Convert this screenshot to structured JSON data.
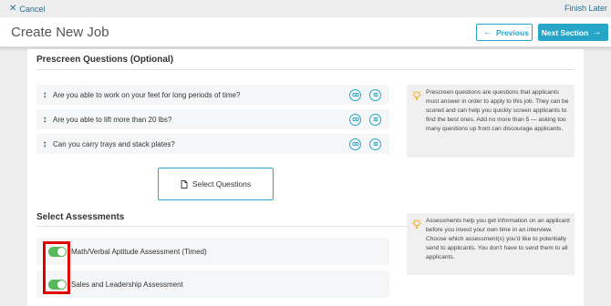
{
  "topbar": {
    "cancel_label": "Cancel",
    "finish_label": "Finish Later"
  },
  "header": {
    "title": "Create New Job",
    "previous_label": "Previous",
    "next_label": "Next Section"
  },
  "prescreen": {
    "title": "Prescreen Questions (Optional)",
    "questions": [
      "Are you able to work on your feet for long periods of time?",
      "Are you able to lift more than 20 lbs?",
      "Can you carry trays and stack plates?"
    ],
    "select_button_label": "Select Questions",
    "tip": "Prescreen questions are questions that applicants must answer in order to apply to this job. They can be scored and can help you quickly screen applicants to find the best ones. Add no more than 5 — asking too many questions up front can discourage applicants."
  },
  "assessments": {
    "title": "Select Assessments",
    "items": [
      {
        "label": "Math/Verbal Aptitude Assessment (Timed)",
        "enabled": true
      },
      {
        "label": "Sales and Leadership Assessment",
        "enabled": true
      }
    ],
    "tip": "Assessments help you get information on an applicant before you invest your own time in an interview. Choose which assessment(s) you'd like to potentially send to applicants. You don't have to send them to all applicants."
  },
  "colors": {
    "accent": "#27a6c8",
    "toggle_on": "#58b85c",
    "highlight": "#e00000",
    "tip_icon": "#f5a623"
  }
}
